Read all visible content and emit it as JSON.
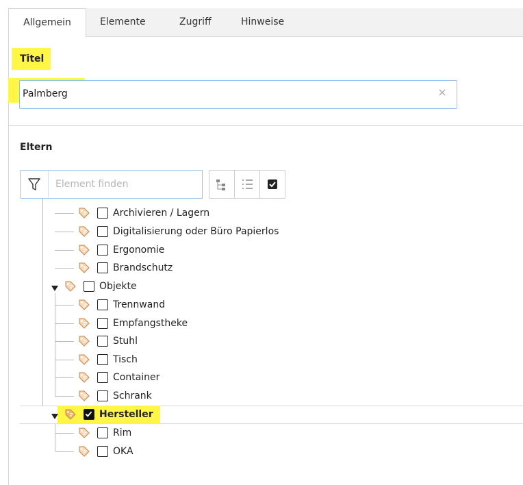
{
  "tabs": [
    {
      "label": "Allgemein",
      "active": true
    },
    {
      "label": "Elemente"
    },
    {
      "label": "Zugriff"
    },
    {
      "label": "Hinweise"
    }
  ],
  "title_field": {
    "label": "Titel",
    "value": "Palmberg"
  },
  "parent": {
    "label": "Eltern",
    "search_placeholder": "Element finden",
    "icons": [
      "filter-icon",
      "tree-view-icon",
      "list-view-icon",
      "checkbox-toggle-icon",
      "clear-icon",
      "tag-icon",
      "caret-down-icon"
    ]
  },
  "tree": [
    {
      "label": "Archivieren / Lagern",
      "checked": false
    },
    {
      "label": "Digitalisierung oder Büro Papierlos",
      "checked": false
    },
    {
      "label": "Ergonomie",
      "checked": false
    },
    {
      "label": "Brandschutz",
      "checked": false
    },
    {
      "label": "Objekte",
      "checked": false,
      "expanded": true
    },
    {
      "label": "Trennwand",
      "checked": false
    },
    {
      "label": "Empfangstheke",
      "checked": false
    },
    {
      "label": "Stuhl",
      "checked": false
    },
    {
      "label": "Tisch",
      "checked": false
    },
    {
      "label": "Container",
      "checked": false
    },
    {
      "label": "Schrank",
      "checked": false
    },
    {
      "label": "Hersteller",
      "checked": true,
      "expanded": true
    },
    {
      "label": "Rim",
      "checked": false
    },
    {
      "label": "OKA",
      "checked": false
    }
  ],
  "colors": {
    "highlight": "#fff645",
    "input_border": "#99c2e6",
    "tag": "#f0b36a"
  }
}
